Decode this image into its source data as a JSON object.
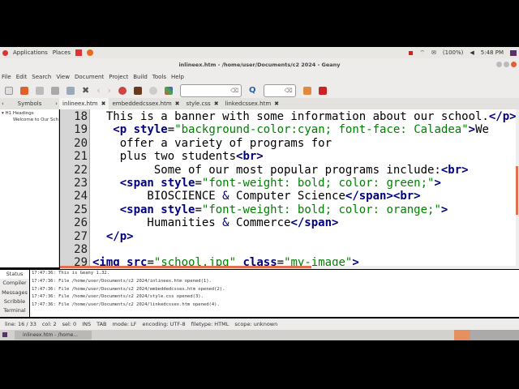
{
  "panel": {
    "applications": "Applications",
    "places": "Places",
    "battery": "(100%)",
    "time": "5:48 PM"
  },
  "window": {
    "title": "inlineex.htm - /home/user/Documents/c2 2024 - Geany"
  },
  "menu": [
    "File",
    "Edit",
    "Search",
    "View",
    "Document",
    "Project",
    "Build",
    "Tools",
    "Help"
  ],
  "sidebar": {
    "tab": "Symbols",
    "group": "H1 Headings",
    "item": "Welcome to Our Sch"
  },
  "tabs": [
    "inlineex.htm",
    "embeddedcssex.htm",
    "style.css",
    "linkedcssex.htm"
  ],
  "code": [
    {
      "n": "18",
      "t": [
        [
          "",
          "  This is a banner with some information about our school."
        ],
        [
          "tag",
          "</p>"
        ]
      ]
    },
    {
      "n": "19",
      "t": [
        [
          "",
          "   "
        ],
        [
          "tag",
          "<p "
        ],
        [
          "attr",
          "style"
        ],
        [
          "",
          "="
        ],
        [
          "str",
          "\"background-color:cyan; font-face: Caladea\""
        ],
        [
          "tag",
          ">"
        ],
        [
          "",
          "We"
        ]
      ]
    },
    {
      "n": "20",
      "t": [
        [
          "",
          "    offer a variety of programs for"
        ]
      ]
    },
    {
      "n": "21",
      "t": [
        [
          "",
          "    plus two students"
        ],
        [
          "tag",
          "<br>"
        ]
      ]
    },
    {
      "n": "22",
      "t": [
        [
          "",
          "         Some of our most popular programs include:"
        ],
        [
          "tag",
          "<br>"
        ]
      ]
    },
    {
      "n": "23",
      "t": [
        [
          "",
          "    "
        ],
        [
          "tag",
          "<span "
        ],
        [
          "attr",
          "style"
        ],
        [
          "",
          "="
        ],
        [
          "str",
          "\"font-weight: bold; color: green;\""
        ],
        [
          "tag",
          ">"
        ]
      ]
    },
    {
      "n": "24",
      "t": [
        [
          "",
          "        BIOSCIENCE "
        ],
        [
          "ent",
          "&amp;"
        ],
        [
          "",
          " Computer Science"
        ],
        [
          "tag",
          "</span><br>"
        ]
      ]
    },
    {
      "n": "25",
      "t": [
        [
          "",
          "    "
        ],
        [
          "tag",
          "<span "
        ],
        [
          "attr",
          "style"
        ],
        [
          "",
          "="
        ],
        [
          "str",
          "\"font-weight: bold; color: orange;\""
        ],
        [
          "tag",
          ">"
        ]
      ]
    },
    {
      "n": "26",
      "t": [
        [
          "",
          "        Humanities "
        ],
        [
          "ent",
          "&amp;"
        ],
        [
          "",
          " Commerce"
        ],
        [
          "tag",
          "</span>"
        ]
      ]
    },
    {
      "n": "27",
      "t": [
        [
          "",
          "  "
        ],
        [
          "tag",
          "</p>"
        ]
      ]
    },
    {
      "n": "28",
      "t": []
    },
    {
      "n": "29",
      "t": [
        [
          "tag",
          "<img "
        ],
        [
          "attr",
          "src"
        ],
        [
          "",
          "="
        ],
        [
          "str",
          "\"school.jpg\""
        ],
        [
          "",
          " "
        ],
        [
          "attr",
          "class"
        ],
        [
          "",
          "="
        ],
        [
          "str",
          "\"my-image\""
        ],
        [
          "tag",
          ">"
        ]
      ]
    }
  ],
  "message_tabs": [
    "Status",
    "Compiler",
    "Messages",
    "Scribble",
    "Terminal"
  ],
  "messages": [
    "17:47:36: This is Geany 1.32.",
    "17:47:36: File /home/user/Documents/c2 2024/inlineex.htm opened(1).",
    "17:47:36: File /home/user/Documents/c2 2024/embeddedcssex.htm opened(2).",
    "17:47:36: File /home/user/Documents/c2 2024/style.css opened(3).",
    "17:47:36: File /home/user/Documents/c2 2024/linkedcssex.htm opened(4)."
  ],
  "status": [
    "line: 16 / 33",
    "col: 2",
    "sel: 0",
    "INS",
    "TAB",
    "mode: LF",
    "encoding: UTF-8",
    "filetype: HTML",
    "scope: unknown"
  ],
  "taskbar": {
    "item": "inlineex.htm - /home..."
  }
}
